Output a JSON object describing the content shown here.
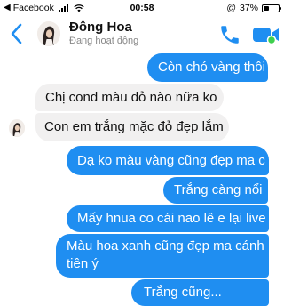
{
  "status_bar": {
    "back_glyph": "◀",
    "back_app": "Facebook",
    "time": "00:58",
    "lock_glyph": "@",
    "battery_percent": "37%",
    "battery_level": 0.37
  },
  "header": {
    "contact_name": "Đông Hoa",
    "presence": "Đang hoạt động",
    "accent_color": "#1f8ef1"
  },
  "messages": [
    {
      "direction": "outgoing",
      "text": "Còn chó vàng thôi"
    },
    {
      "direction": "incoming",
      "text": "Chị cond màu đỏ nào nữa ko"
    },
    {
      "direction": "incoming",
      "text": "Con em trắng mặc đỏ đẹp lắm"
    },
    {
      "direction": "outgoing",
      "text": "Dạ ko màu vàng cũng đẹp ma c"
    },
    {
      "direction": "outgoing",
      "text": "Trắng càng nổi"
    },
    {
      "direction": "outgoing",
      "text": "Mấy hnua co cái nao lê e lại live"
    },
    {
      "direction": "outgoing",
      "text": "Màu hoa xanh cũng đẹp ma cánh",
      "text2": "tiên ý"
    },
    {
      "direction": "outgoing",
      "text": "Trắng cũng..."
    }
  ]
}
